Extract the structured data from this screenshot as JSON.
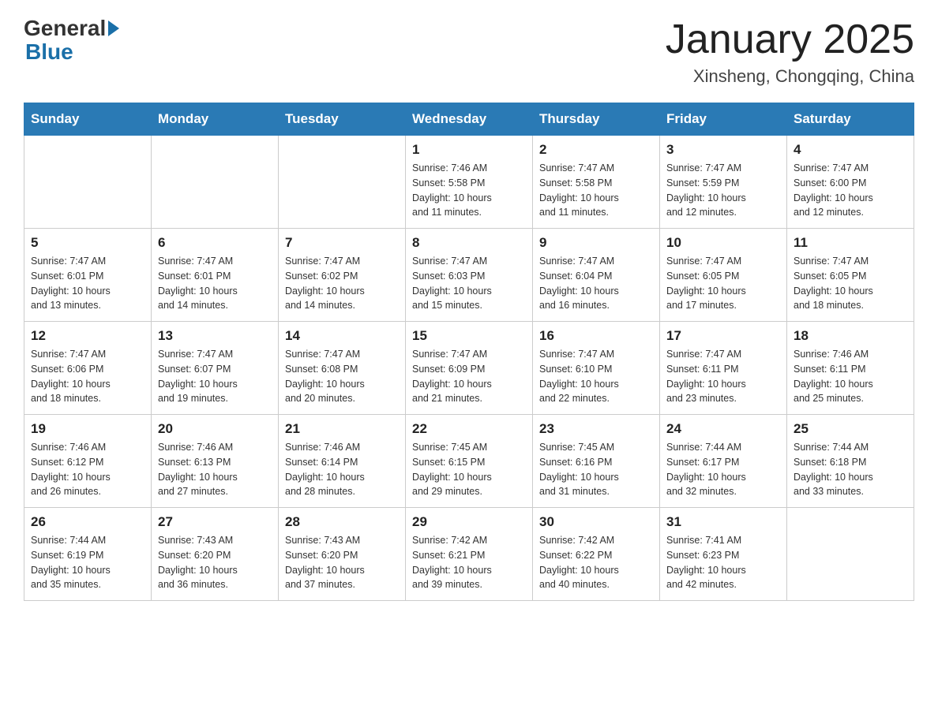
{
  "header": {
    "title": "January 2025",
    "subtitle": "Xinsheng, Chongqing, China",
    "logo": {
      "general": "General",
      "blue": "Blue"
    }
  },
  "weekdays": [
    "Sunday",
    "Monday",
    "Tuesday",
    "Wednesday",
    "Thursday",
    "Friday",
    "Saturday"
  ],
  "weeks": [
    [
      {
        "day": "",
        "info": ""
      },
      {
        "day": "",
        "info": ""
      },
      {
        "day": "",
        "info": ""
      },
      {
        "day": "1",
        "info": "Sunrise: 7:46 AM\nSunset: 5:58 PM\nDaylight: 10 hours\nand 11 minutes."
      },
      {
        "day": "2",
        "info": "Sunrise: 7:47 AM\nSunset: 5:58 PM\nDaylight: 10 hours\nand 11 minutes."
      },
      {
        "day": "3",
        "info": "Sunrise: 7:47 AM\nSunset: 5:59 PM\nDaylight: 10 hours\nand 12 minutes."
      },
      {
        "day": "4",
        "info": "Sunrise: 7:47 AM\nSunset: 6:00 PM\nDaylight: 10 hours\nand 12 minutes."
      }
    ],
    [
      {
        "day": "5",
        "info": "Sunrise: 7:47 AM\nSunset: 6:01 PM\nDaylight: 10 hours\nand 13 minutes."
      },
      {
        "day": "6",
        "info": "Sunrise: 7:47 AM\nSunset: 6:01 PM\nDaylight: 10 hours\nand 14 minutes."
      },
      {
        "day": "7",
        "info": "Sunrise: 7:47 AM\nSunset: 6:02 PM\nDaylight: 10 hours\nand 14 minutes."
      },
      {
        "day": "8",
        "info": "Sunrise: 7:47 AM\nSunset: 6:03 PM\nDaylight: 10 hours\nand 15 minutes."
      },
      {
        "day": "9",
        "info": "Sunrise: 7:47 AM\nSunset: 6:04 PM\nDaylight: 10 hours\nand 16 minutes."
      },
      {
        "day": "10",
        "info": "Sunrise: 7:47 AM\nSunset: 6:05 PM\nDaylight: 10 hours\nand 17 minutes."
      },
      {
        "day": "11",
        "info": "Sunrise: 7:47 AM\nSunset: 6:05 PM\nDaylight: 10 hours\nand 18 minutes."
      }
    ],
    [
      {
        "day": "12",
        "info": "Sunrise: 7:47 AM\nSunset: 6:06 PM\nDaylight: 10 hours\nand 18 minutes."
      },
      {
        "day": "13",
        "info": "Sunrise: 7:47 AM\nSunset: 6:07 PM\nDaylight: 10 hours\nand 19 minutes."
      },
      {
        "day": "14",
        "info": "Sunrise: 7:47 AM\nSunset: 6:08 PM\nDaylight: 10 hours\nand 20 minutes."
      },
      {
        "day": "15",
        "info": "Sunrise: 7:47 AM\nSunset: 6:09 PM\nDaylight: 10 hours\nand 21 minutes."
      },
      {
        "day": "16",
        "info": "Sunrise: 7:47 AM\nSunset: 6:10 PM\nDaylight: 10 hours\nand 22 minutes."
      },
      {
        "day": "17",
        "info": "Sunrise: 7:47 AM\nSunset: 6:11 PM\nDaylight: 10 hours\nand 23 minutes."
      },
      {
        "day": "18",
        "info": "Sunrise: 7:46 AM\nSunset: 6:11 PM\nDaylight: 10 hours\nand 25 minutes."
      }
    ],
    [
      {
        "day": "19",
        "info": "Sunrise: 7:46 AM\nSunset: 6:12 PM\nDaylight: 10 hours\nand 26 minutes."
      },
      {
        "day": "20",
        "info": "Sunrise: 7:46 AM\nSunset: 6:13 PM\nDaylight: 10 hours\nand 27 minutes."
      },
      {
        "day": "21",
        "info": "Sunrise: 7:46 AM\nSunset: 6:14 PM\nDaylight: 10 hours\nand 28 minutes."
      },
      {
        "day": "22",
        "info": "Sunrise: 7:45 AM\nSunset: 6:15 PM\nDaylight: 10 hours\nand 29 minutes."
      },
      {
        "day": "23",
        "info": "Sunrise: 7:45 AM\nSunset: 6:16 PM\nDaylight: 10 hours\nand 31 minutes."
      },
      {
        "day": "24",
        "info": "Sunrise: 7:44 AM\nSunset: 6:17 PM\nDaylight: 10 hours\nand 32 minutes."
      },
      {
        "day": "25",
        "info": "Sunrise: 7:44 AM\nSunset: 6:18 PM\nDaylight: 10 hours\nand 33 minutes."
      }
    ],
    [
      {
        "day": "26",
        "info": "Sunrise: 7:44 AM\nSunset: 6:19 PM\nDaylight: 10 hours\nand 35 minutes."
      },
      {
        "day": "27",
        "info": "Sunrise: 7:43 AM\nSunset: 6:20 PM\nDaylight: 10 hours\nand 36 minutes."
      },
      {
        "day": "28",
        "info": "Sunrise: 7:43 AM\nSunset: 6:20 PM\nDaylight: 10 hours\nand 37 minutes."
      },
      {
        "day": "29",
        "info": "Sunrise: 7:42 AM\nSunset: 6:21 PM\nDaylight: 10 hours\nand 39 minutes."
      },
      {
        "day": "30",
        "info": "Sunrise: 7:42 AM\nSunset: 6:22 PM\nDaylight: 10 hours\nand 40 minutes."
      },
      {
        "day": "31",
        "info": "Sunrise: 7:41 AM\nSunset: 6:23 PM\nDaylight: 10 hours\nand 42 minutes."
      },
      {
        "day": "",
        "info": ""
      }
    ]
  ]
}
